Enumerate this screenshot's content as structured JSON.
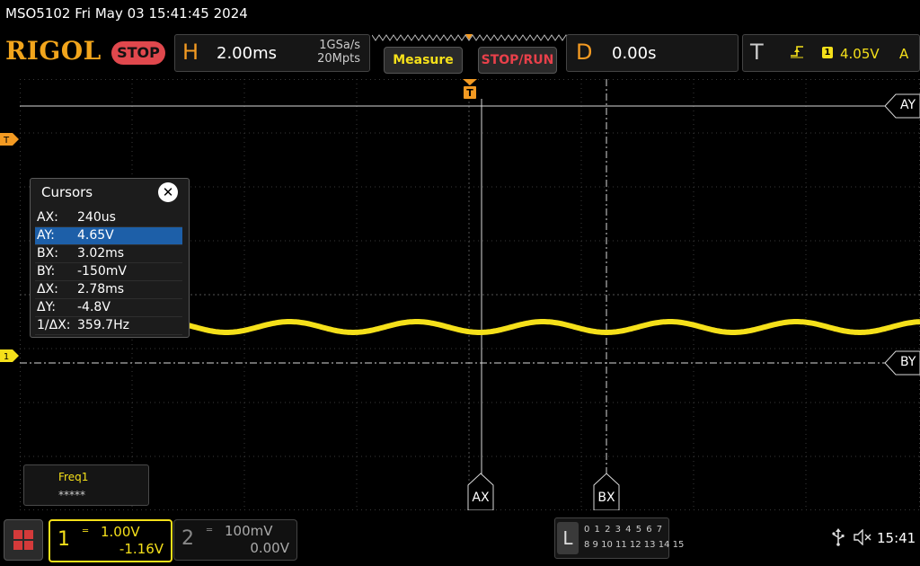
{
  "header": {
    "title_line": "MSO5102  Fri May 03 15:41:45 2024"
  },
  "toolbar": {
    "logo": "RIGOL",
    "run_state": "STOP",
    "horizontal": {
      "letter": "H",
      "timebase": "2.00ms",
      "sample_rate": "1GSa/s",
      "memory_depth": "20Mpts"
    },
    "measure_label": "Measure",
    "stoprun_label": "STOP/RUN",
    "delay": {
      "letter": "D",
      "value": "0.00s"
    },
    "trigger": {
      "letter": "T",
      "source": "1",
      "level": "4.05V",
      "mode": "A"
    }
  },
  "markers": {
    "trigger_left": "T",
    "ch1_ground": "1",
    "ay_tag": "AY",
    "by_tag": "BY",
    "ax_tag": "AX",
    "bx_tag": "BX"
  },
  "cursor_panel": {
    "title": "Cursors",
    "rows": [
      {
        "key": "AX:",
        "value": "240us",
        "selected": false
      },
      {
        "key": "AY:",
        "value": "4.65V",
        "selected": true
      },
      {
        "key": "BX:",
        "value": "3.02ms",
        "selected": false
      },
      {
        "key": "BY:",
        "value": "-150mV",
        "selected": false
      },
      {
        "key": "ΔX:",
        "value": "2.78ms",
        "selected": false
      },
      {
        "key": "ΔY:",
        "value": "-4.8V",
        "selected": false
      },
      {
        "key": "1/ΔX:",
        "value": "359.7Hz",
        "selected": false
      }
    ]
  },
  "measurement": {
    "label": "Freq1",
    "value": "*****"
  },
  "channels": [
    {
      "number": "1",
      "scale": "1.00V",
      "offset": "-1.16V",
      "active": true,
      "color": "#f5e01a"
    },
    {
      "number": "2",
      "scale": "100mV",
      "offset": "0.00V",
      "active": false,
      "color": "#888888"
    }
  ],
  "logic": {
    "letter": "L",
    "row1": "0 1 2 3  4 5 6 7",
    "row2": "8 9 10 11  12 13 14 15"
  },
  "status": {
    "clock": "15:41"
  },
  "colors": {
    "ch1": "#f5e01a",
    "brand": "#f2a51c",
    "trigger_marker": "#f39a22",
    "stop_red": "#e0484d"
  },
  "icons": [
    "menu-icon",
    "usb-icon",
    "speaker-muted-icon",
    "close-icon",
    "trigger-rising-edge-icon"
  ]
}
